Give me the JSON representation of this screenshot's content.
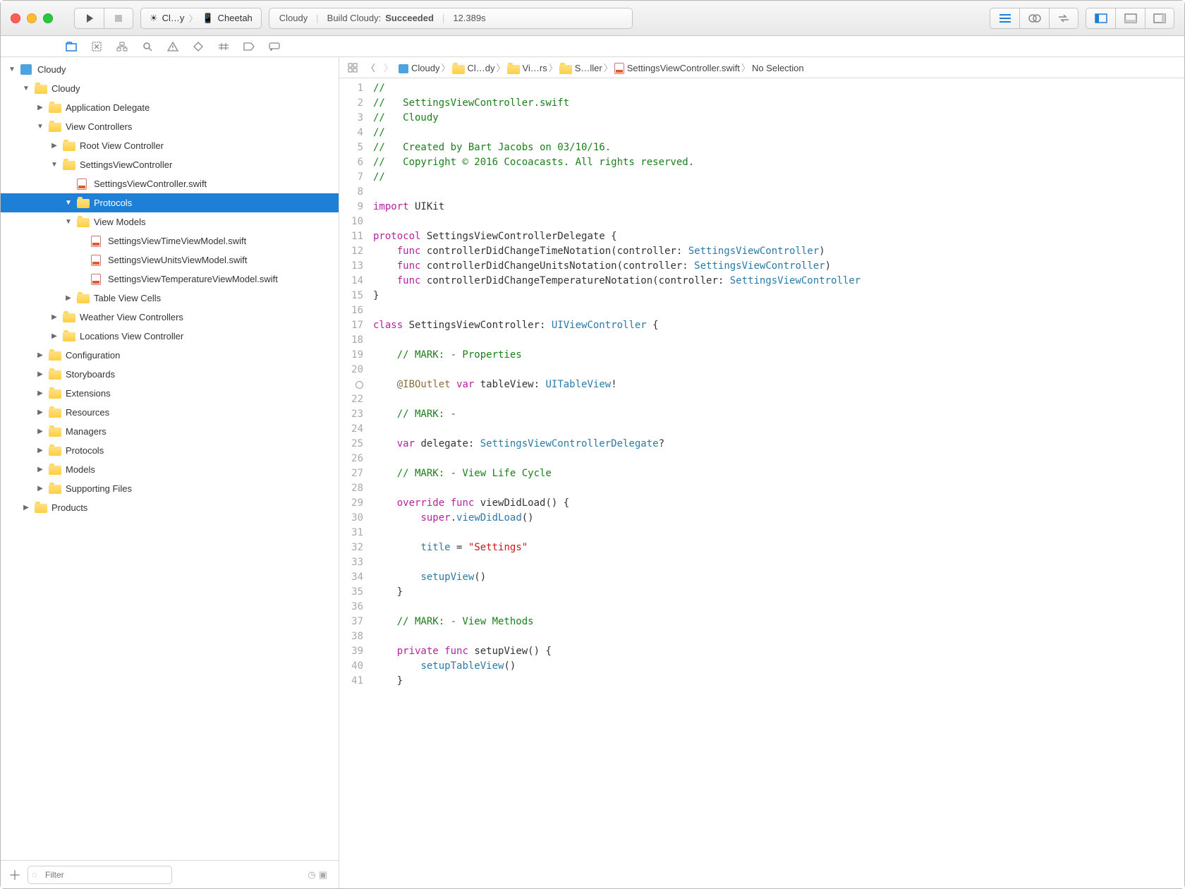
{
  "titlebar": {
    "scheme_app": "Cl…y",
    "scheme_device": "Cheetah",
    "status_project": "Cloudy",
    "status_action": "Build Cloudy:",
    "status_result": "Succeeded",
    "status_time": "12.389s"
  },
  "jumpbar": {
    "items": [
      "Cloudy",
      "Cl…dy",
      "Vi…rs",
      "S…ller",
      "SettingsViewController.swift",
      "No Selection"
    ]
  },
  "tree": [
    {
      "indent": 0,
      "kind": "proj",
      "disc": "down",
      "label": "Cloudy"
    },
    {
      "indent": 1,
      "kind": "folder",
      "disc": "down",
      "label": "Cloudy"
    },
    {
      "indent": 2,
      "kind": "folder",
      "disc": "right",
      "label": "Application Delegate"
    },
    {
      "indent": 2,
      "kind": "folder",
      "disc": "down",
      "label": "View Controllers"
    },
    {
      "indent": 3,
      "kind": "folder",
      "disc": "right",
      "label": "Root View Controller"
    },
    {
      "indent": 3,
      "kind": "folder",
      "disc": "down",
      "label": "SettingsViewController"
    },
    {
      "indent": 4,
      "kind": "swift",
      "disc": "none",
      "label": "SettingsViewController.swift"
    },
    {
      "indent": 4,
      "kind": "folder",
      "disc": "down",
      "label": "Protocols",
      "selected": true
    },
    {
      "indent": 4,
      "kind": "folder",
      "disc": "down",
      "label": "View Models"
    },
    {
      "indent": 5,
      "kind": "swift",
      "disc": "none",
      "label": "SettingsViewTimeViewModel.swift"
    },
    {
      "indent": 5,
      "kind": "swift",
      "disc": "none",
      "label": "SettingsViewUnitsViewModel.swift"
    },
    {
      "indent": 5,
      "kind": "swift",
      "disc": "none",
      "label": "SettingsViewTemperatureViewModel.swift"
    },
    {
      "indent": 4,
      "kind": "folder",
      "disc": "right",
      "label": "Table View Cells"
    },
    {
      "indent": 3,
      "kind": "folder",
      "disc": "right",
      "label": "Weather View Controllers"
    },
    {
      "indent": 3,
      "kind": "folder",
      "disc": "right",
      "label": "Locations View Controller"
    },
    {
      "indent": 2,
      "kind": "folder",
      "disc": "right",
      "label": "Configuration"
    },
    {
      "indent": 2,
      "kind": "folder",
      "disc": "right",
      "label": "Storyboards"
    },
    {
      "indent": 2,
      "kind": "folder",
      "disc": "right",
      "label": "Extensions"
    },
    {
      "indent": 2,
      "kind": "folder",
      "disc": "right",
      "label": "Resources"
    },
    {
      "indent": 2,
      "kind": "folder",
      "disc": "right",
      "label": "Managers"
    },
    {
      "indent": 2,
      "kind": "folder",
      "disc": "right",
      "label": "Protocols"
    },
    {
      "indent": 2,
      "kind": "folder",
      "disc": "right",
      "label": "Models"
    },
    {
      "indent": 2,
      "kind": "folder",
      "disc": "right",
      "label": "Supporting Files"
    },
    {
      "indent": 1,
      "kind": "folder",
      "disc": "right",
      "label": "Products"
    }
  ],
  "filter": {
    "placeholder": "Filter"
  },
  "code": {
    "lines": [
      [
        {
          "t": "//",
          "c": "comment"
        }
      ],
      [
        {
          "t": "//   SettingsViewController.swift",
          "c": "comment"
        }
      ],
      [
        {
          "t": "//   Cloudy",
          "c": "comment"
        }
      ],
      [
        {
          "t": "//",
          "c": "comment"
        }
      ],
      [
        {
          "t": "//   Created by Bart Jacobs on 03/10/16.",
          "c": "comment"
        }
      ],
      [
        {
          "t": "//   Copyright © 2016 Cocoacasts. All rights reserved.",
          "c": "comment"
        }
      ],
      [
        {
          "t": "//",
          "c": "comment"
        }
      ],
      [],
      [
        {
          "t": "import",
          "c": "keyword"
        },
        {
          "t": " UIKit"
        }
      ],
      [],
      [
        {
          "t": "protocol",
          "c": "keyword"
        },
        {
          "t": " SettingsViewControllerDelegate {"
        }
      ],
      [
        {
          "t": "    "
        },
        {
          "t": "func",
          "c": "keyword"
        },
        {
          "t": " controllerDidChangeTimeNotation(controller: "
        },
        {
          "t": "SettingsViewController",
          "c": "type"
        },
        {
          "t": ")"
        }
      ],
      [
        {
          "t": "    "
        },
        {
          "t": "func",
          "c": "keyword"
        },
        {
          "t": " controllerDidChangeUnitsNotation(controller: "
        },
        {
          "t": "SettingsViewController",
          "c": "type"
        },
        {
          "t": ")"
        }
      ],
      [
        {
          "t": "    "
        },
        {
          "t": "func",
          "c": "keyword"
        },
        {
          "t": " controllerDidChangeTemperatureNotation(controller: "
        },
        {
          "t": "SettingsViewController",
          "c": "type"
        }
      ],
      [
        {
          "t": "}"
        }
      ],
      [],
      [
        {
          "t": "class",
          "c": "keyword"
        },
        {
          "t": " SettingsViewController: "
        },
        {
          "t": "UIViewController",
          "c": "type"
        },
        {
          "t": " {"
        }
      ],
      [],
      [
        {
          "t": "    "
        },
        {
          "t": "// MARK: - Properties",
          "c": "comment"
        }
      ],
      [],
      [
        {
          "t": "    "
        },
        {
          "t": "@IBOutlet",
          "c": "attr"
        },
        {
          "t": " "
        },
        {
          "t": "var",
          "c": "keyword"
        },
        {
          "t": " tableView: "
        },
        {
          "t": "UITableView",
          "c": "type"
        },
        {
          "t": "!"
        }
      ],
      [],
      [
        {
          "t": "    "
        },
        {
          "t": "// MARK: -",
          "c": "comment"
        }
      ],
      [],
      [
        {
          "t": "    "
        },
        {
          "t": "var",
          "c": "keyword"
        },
        {
          "t": " delegate: "
        },
        {
          "t": "SettingsViewControllerDelegate",
          "c": "type"
        },
        {
          "t": "?"
        }
      ],
      [],
      [
        {
          "t": "    "
        },
        {
          "t": "// MARK: - View Life Cycle",
          "c": "comment"
        }
      ],
      [],
      [
        {
          "t": "    "
        },
        {
          "t": "override",
          "c": "keyword"
        },
        {
          "t": " "
        },
        {
          "t": "func",
          "c": "keyword"
        },
        {
          "t": " viewDidLoad() {"
        }
      ],
      [
        {
          "t": "        "
        },
        {
          "t": "super",
          "c": "keyword"
        },
        {
          "t": "."
        },
        {
          "t": "viewDidLoad",
          "c": "type"
        },
        {
          "t": "()"
        }
      ],
      [],
      [
        {
          "t": "        "
        },
        {
          "t": "title",
          "c": "type"
        },
        {
          "t": " = "
        },
        {
          "t": "\"Settings\"",
          "c": "string"
        }
      ],
      [],
      [
        {
          "t": "        "
        },
        {
          "t": "setupView",
          "c": "type"
        },
        {
          "t": "()"
        }
      ],
      [
        {
          "t": "    }"
        }
      ],
      [],
      [
        {
          "t": "    "
        },
        {
          "t": "// MARK: - View Methods",
          "c": "comment"
        }
      ],
      [],
      [
        {
          "t": "    "
        },
        {
          "t": "private",
          "c": "keyword"
        },
        {
          "t": " "
        },
        {
          "t": "func",
          "c": "keyword"
        },
        {
          "t": " setupView() {"
        }
      ],
      [
        {
          "t": "        "
        },
        {
          "t": "setupTableView",
          "c": "type"
        },
        {
          "t": "()"
        }
      ],
      [
        {
          "t": "    }"
        }
      ]
    ],
    "outlet_line": 21
  }
}
